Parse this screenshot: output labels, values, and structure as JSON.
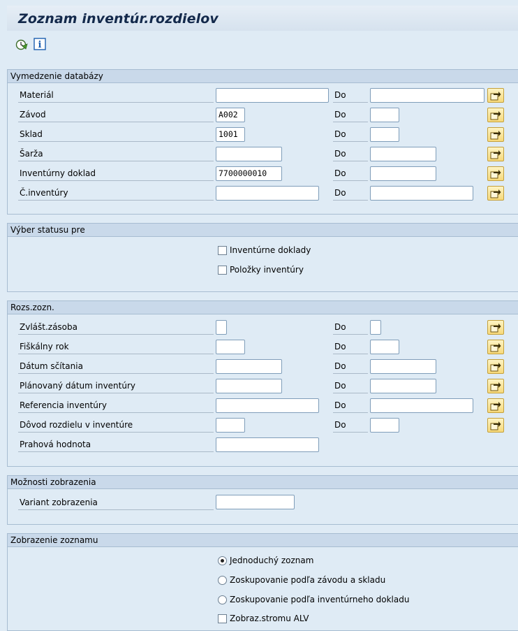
{
  "title": "Zoznam inventúr.rozdielov",
  "toolbar": {
    "execute_icon": "execute-clock-icon",
    "info_icon": "info-icon",
    "info_glyph": "i"
  },
  "sections": {
    "db": {
      "header": "Vymedzenie databázy",
      "to_label": "Do",
      "rows": [
        {
          "label": "Materiál",
          "from": "",
          "to": ""
        },
        {
          "label": "Závod",
          "from": "A002",
          "to": ""
        },
        {
          "label": "Sklad",
          "from": "1001",
          "to": ""
        },
        {
          "label": "Šarža",
          "from": "",
          "to": ""
        },
        {
          "label": "Inventúrny doklad",
          "from": "7700000010",
          "to": ""
        },
        {
          "label": "Č.inventúry",
          "from": "",
          "to": ""
        }
      ]
    },
    "status": {
      "header": "Výber statusu pre",
      "options": [
        {
          "label": "Inventúrne doklady",
          "checked": false
        },
        {
          "label": "Položky inventúry",
          "checked": false
        }
      ]
    },
    "scope": {
      "header": "Rozs.zozn.",
      "to_label": "Do",
      "rows": [
        {
          "label": "Zvlášt.zásoba",
          "from": "",
          "to": ""
        },
        {
          "label": "Fiškálny rok",
          "from": "",
          "to": ""
        },
        {
          "label": "Dátum sčítania",
          "from": "",
          "to": ""
        },
        {
          "label": "Plánovaný dátum inventúry",
          "from": "",
          "to": ""
        },
        {
          "label": "Referencia inventúry",
          "from": "",
          "to": ""
        },
        {
          "label": "Dôvod rozdielu v inventúre",
          "from": "",
          "to": ""
        },
        {
          "label": "Prahová hodnota",
          "from": ""
        }
      ]
    },
    "display": {
      "header": "Možnosti zobrazenia",
      "label": "Variant zobrazenia",
      "value": ""
    },
    "list": {
      "header": "Zobrazenie zoznamu",
      "options": [
        {
          "label": "Jednoduchý zoznam",
          "selected": true
        },
        {
          "label": "Zoskupovanie podľa závodu a skladu",
          "selected": false
        },
        {
          "label": "Zoskupovanie podľa inventúrneho dokladu",
          "selected": false
        }
      ],
      "tree_label": "Zobraz.stromu ALV",
      "tree_checked": false
    }
  },
  "colors": {
    "background": "#dfebf5",
    "section_header": "#c9d9ea",
    "title_text": "#13294b",
    "multi_select_button": "#f7d97a"
  }
}
